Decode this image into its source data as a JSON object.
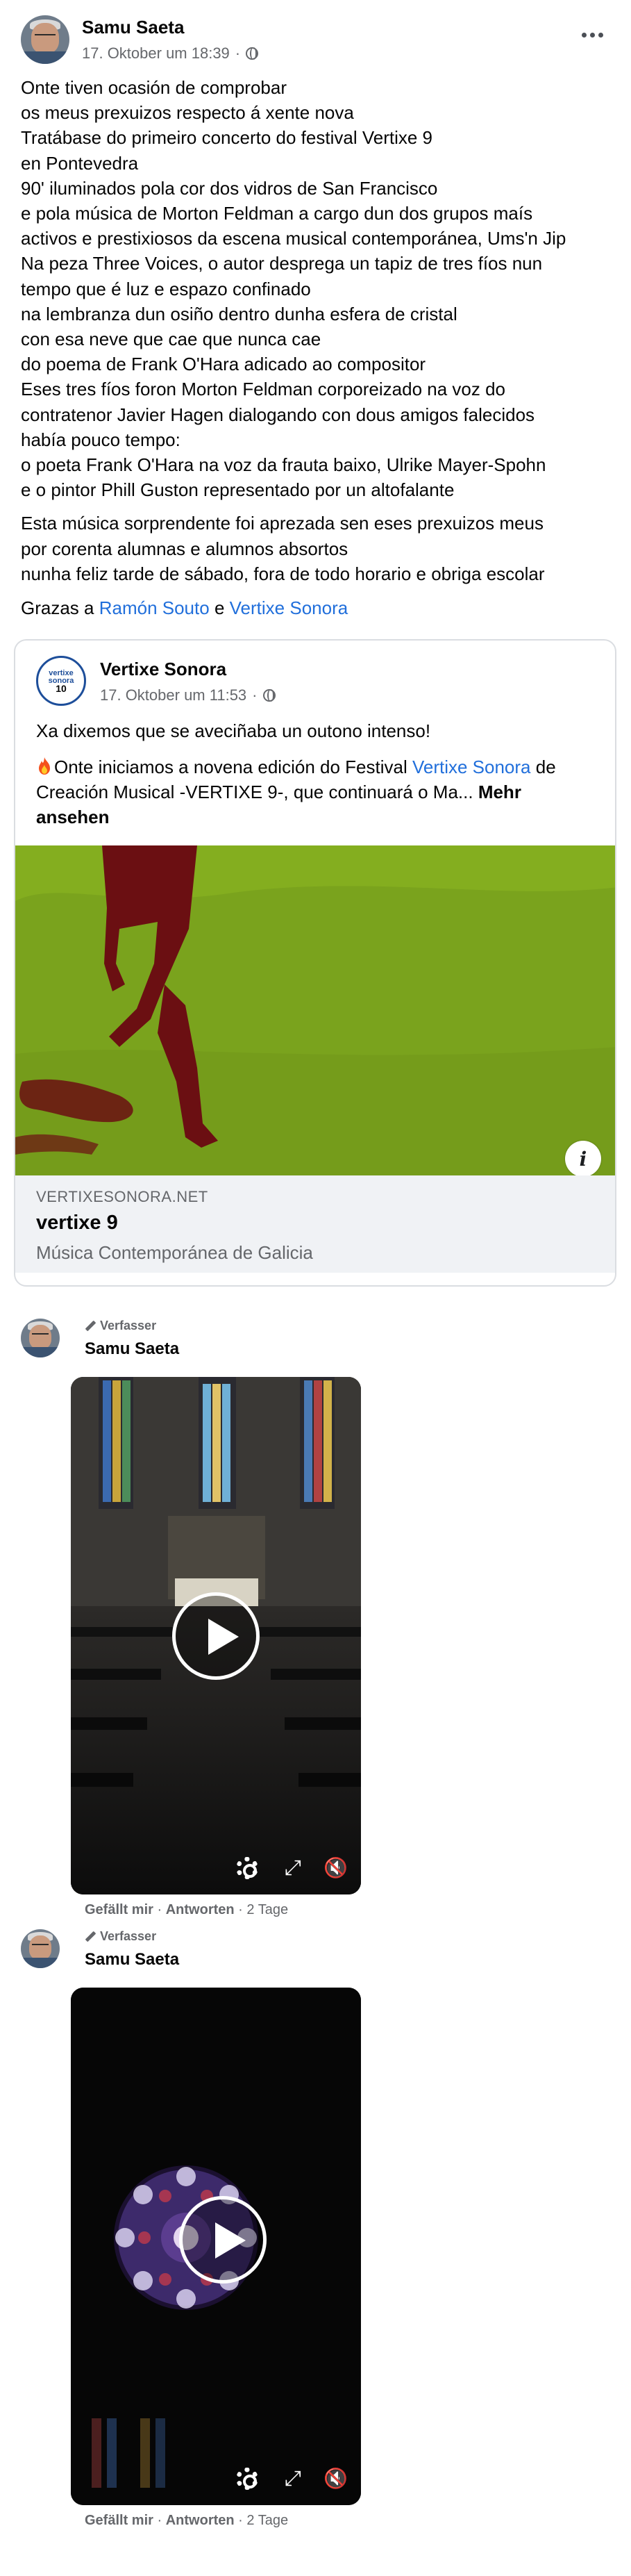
{
  "post": {
    "author": "Samu Saeta",
    "timestamp": "17. Oktober um 18:39",
    "separator": "·",
    "more_icon": "more-horizontal-icon",
    "body_lines": [
      "Onte tiven ocasión de comprobar",
      "os meus prexuizos respecto á xente nova",
      "Tratábase do primeiro concerto do festival Vertixe 9",
      "en Pontevedra",
      "90' iluminados pola cor dos vidros de San Francisco",
      "e pola música de Morton Feldman a cargo dun dos grupos maís",
      "activos e prestixiosos da escena musical contemporánea, Ums'n Jip",
      "Na peza Three Voices, o autor despregа un tapiz de tres fíos nun",
      "tempo que é luz e espazo confinado",
      "na lembranza dun osiño dentro dunha esfera de cristal",
      "con esa neve que cae que nunca cae",
      "do poema de Frank O'Hara adicado ao compositor",
      "Eses tres fíos foron Morton Feldman corporeizado na voz do",
      "contratenor Javier Hagen dialogando con dous amigos falecidos",
      "había pouco tempo:",
      "o poeta Frank O'Hara na voz da frauta baixo, Ulrike Mayer-Spohn",
      "e o pintor Phill Guston representado por un altofalante"
    ],
    "body_lines_2": [
      "Esta música sorprendente foi aprezada sen eses prexuizos meus",
      "por corenta alumnas e alumnos absortos",
      "nunha feliz tarde de sábado, fora de todo horario e obriga escolar"
    ],
    "thanks_prefix": "Grazas  a ",
    "mention_1": "Ramón Souto",
    "thanks_conj": "e",
    "mention_2": "Vertixe Sonora"
  },
  "shared": {
    "page_name": "Vertixe Sonora",
    "logo_line1": "vertixe",
    "logo_line2": "sonora",
    "logo_number": "10",
    "timestamp": "17. Oktober um 11:53",
    "separator": "·",
    "text_1": "Xa dixemos que se aveciñaba un outono intenso!",
    "text_2_a": "Onte iniciamos a novena edición do Festival ",
    "text_2_link": "Vertixe Sonora",
    "text_2_b": "de Creación Musical -VERTIXE 9-, que continuará o Ma...",
    "see_more": "Mehr ansehen",
    "fire_icon": "fire-emoji-icon",
    "link_domain": "VERTIXESONORA.NET",
    "link_title": "vertixe 9",
    "link_desc": "Música Contemporánea de Galicia",
    "info_label": "i"
  },
  "comments": [
    {
      "badge": "Verfasser",
      "author": "Samu Saeta",
      "like": "Gefällt mir",
      "reply": "Antworten",
      "age": "2 Tage",
      "dot": "·"
    },
    {
      "badge": "Verfasser",
      "author": "Samu Saeta",
      "like": "Gefällt mir",
      "reply": "Antworten",
      "age": "2 Tage",
      "dot": "·"
    }
  ],
  "colors": {
    "link": "#216fdb",
    "secondary_text": "#65676b",
    "card_border": "#dadde1",
    "link_info_bg": "#f0f2f5",
    "image_green": "#7aa31d",
    "image_red": "#6b0f12"
  }
}
